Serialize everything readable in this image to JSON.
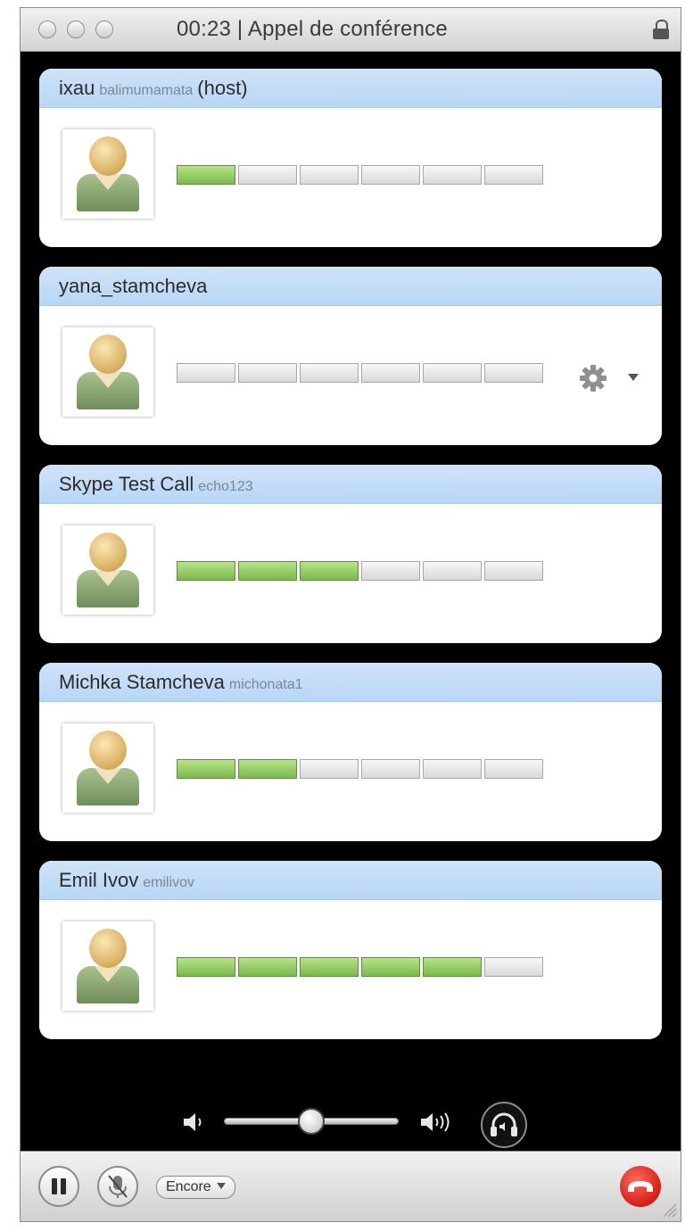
{
  "window": {
    "title": "00:23 | Appel de conférence"
  },
  "participants": [
    {
      "name": "ixau",
      "username": "balimumamata",
      "role": "(host)",
      "level": 1,
      "has_settings": false
    },
    {
      "name": "yana_stamcheva",
      "username": "",
      "role": "",
      "level": 0,
      "has_settings": true
    },
    {
      "name": "Skype Test Call",
      "username": "echo123",
      "role": "",
      "level": 3,
      "has_settings": false
    },
    {
      "name": "Michka Stamcheva",
      "username": "michonata1",
      "role": "",
      "level": 2,
      "has_settings": false
    },
    {
      "name": "Emil Ivov",
      "username": "emilivov",
      "role": "",
      "level": 5,
      "has_settings": false
    }
  ],
  "meter": {
    "segments": 6
  },
  "volume": {
    "level": 0.5
  },
  "toolbar": {
    "more_label": "Encore"
  },
  "colors": {
    "header_blue": "#bcd8f5",
    "meter_on": "#8cc65c",
    "hangup_red": "#d9241a"
  },
  "icons": [
    "pause-icon",
    "mic-mute-icon",
    "hangup-icon",
    "speaker-low-icon",
    "speaker-high-icon",
    "headset-icon",
    "gear-icon",
    "lock-icon"
  ]
}
